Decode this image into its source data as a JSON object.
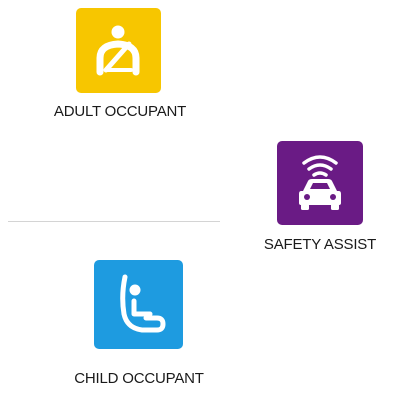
{
  "categories": [
    {
      "id": "adult",
      "label": "ADULT OCCUPANT",
      "icon": "adult-occupant-seatbelt-icon",
      "color": "#f7c600"
    },
    {
      "id": "safety",
      "label": "SAFETY ASSIST",
      "icon": "safety-assist-car-sensor-icon",
      "color": "#6a1b85"
    },
    {
      "id": "child",
      "label": "CHILD OCCUPANT",
      "icon": "child-occupant-seat-icon",
      "color": "#1e9be0"
    }
  ]
}
